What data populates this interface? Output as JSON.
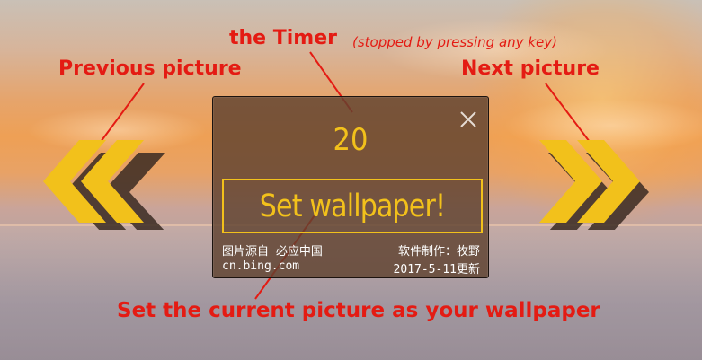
{
  "annotations": {
    "timer_label": "the Timer",
    "timer_note": "(stopped by pressing any key)",
    "previous": "Previous picture",
    "next": "Next picture",
    "set_current": "Set the current picture as your wallpaper"
  },
  "dialog": {
    "timer_value": "20",
    "set_button_label": "Set wallpaper!",
    "source_label": "图片源自 必应中国",
    "source_link": "cn.bing.com",
    "author_label": "软件制作：牧野",
    "updated_label": "2017-5-11更新"
  },
  "colors": {
    "accent": "#f2c11b",
    "annotation": "#e41b13",
    "dialog_bg": "#5f4230"
  },
  "icons": {
    "previous": "double-chevron-left-icon",
    "next": "double-chevron-right-icon",
    "close": "close-icon"
  }
}
